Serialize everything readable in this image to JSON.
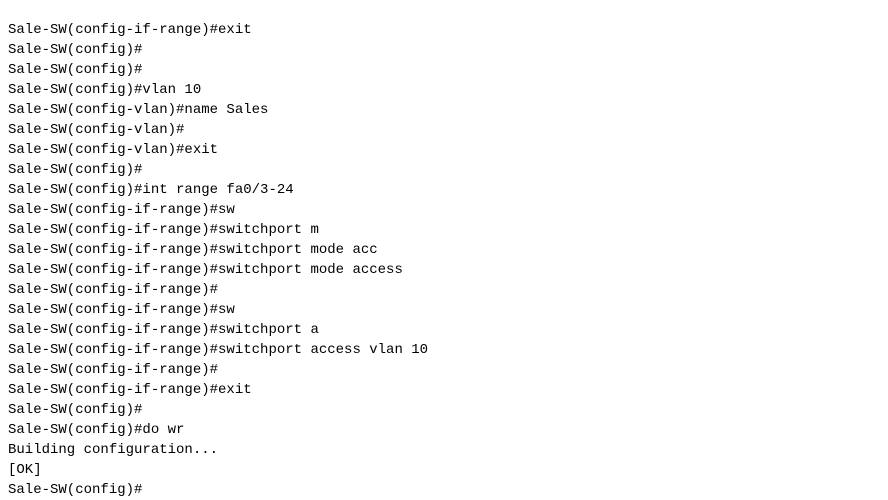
{
  "terminal": {
    "lines": [
      "Sale-SW(config-if-range)#exit",
      "Sale-SW(config)#",
      "Sale-SW(config)#",
      "Sale-SW(config)#vlan 10",
      "Sale-SW(config-vlan)#name Sales",
      "Sale-SW(config-vlan)#",
      "Sale-SW(config-vlan)#exit",
      "Sale-SW(config)#",
      "Sale-SW(config)#int range fa0/3-24",
      "Sale-SW(config-if-range)#sw",
      "Sale-SW(config-if-range)#switchport m",
      "Sale-SW(config-if-range)#switchport mode acc",
      "Sale-SW(config-if-range)#switchport mode access",
      "Sale-SW(config-if-range)#",
      "Sale-SW(config-if-range)#sw",
      "Sale-SW(config-if-range)#switchport a",
      "Sale-SW(config-if-range)#switchport access vlan 10",
      "Sale-SW(config-if-range)#",
      "Sale-SW(config-if-range)#exit",
      "Sale-SW(config)#",
      "Sale-SW(config)#do wr",
      "Building configuration...",
      "[OK]",
      "Sale-SW(config)#"
    ]
  }
}
